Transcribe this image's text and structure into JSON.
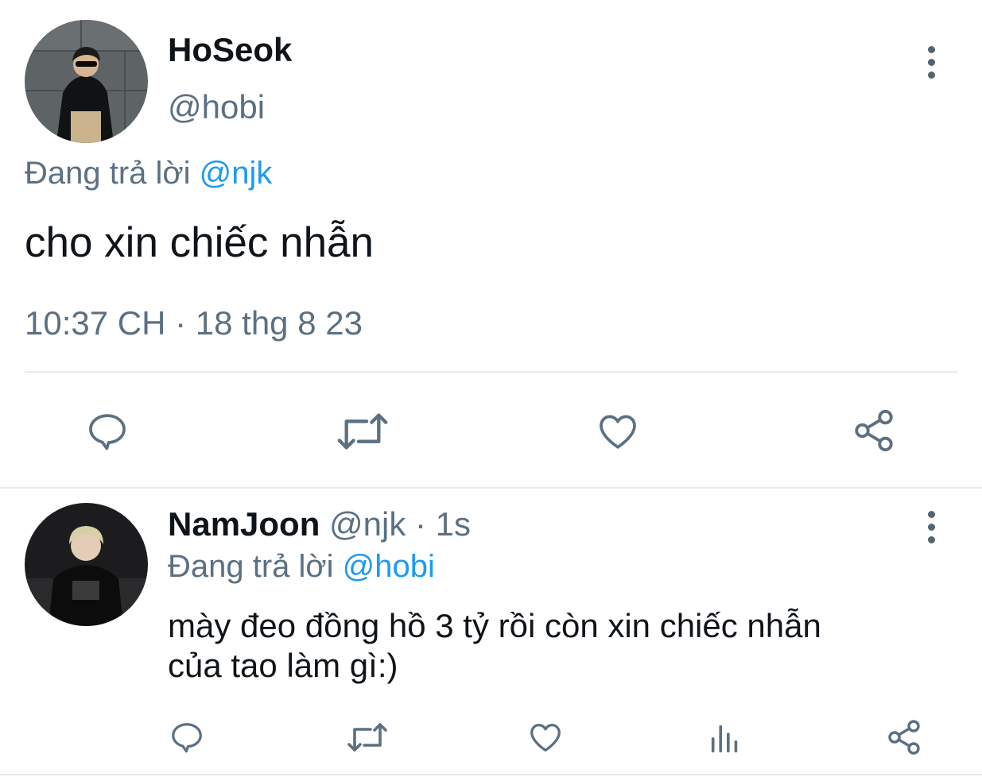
{
  "main_tweet": {
    "display_name": "HoSeok",
    "handle": "@hobi",
    "reply_prefix": "Đang trả lời",
    "reply_to": "@njk",
    "text": "cho xin chiếc nhẫn",
    "timestamp": "10:37 CH · 18 thg 8 23",
    "actions": [
      "comment-icon",
      "retweet-icon",
      "heart-icon",
      "share-icon"
    ]
  },
  "reply_tweet": {
    "display_name": "NamJoon",
    "handle": "@njk",
    "time": "· 1s",
    "reply_prefix": "Đang trả lời",
    "reply_to": "@hobi",
    "text_line1": "mày đeo đồng hồ 3 tỷ rồi còn xin chiếc nhẫn",
    "text_line2": "của tao làm gì:)",
    "actions": [
      "comment-icon",
      "retweet-icon",
      "heart-icon",
      "analytics-icon",
      "share-icon"
    ]
  },
  "colors": {
    "text": "#0f1419",
    "secondary": "#5b7083",
    "link": "#1d9bf0",
    "divider": "#e6ecf0"
  }
}
